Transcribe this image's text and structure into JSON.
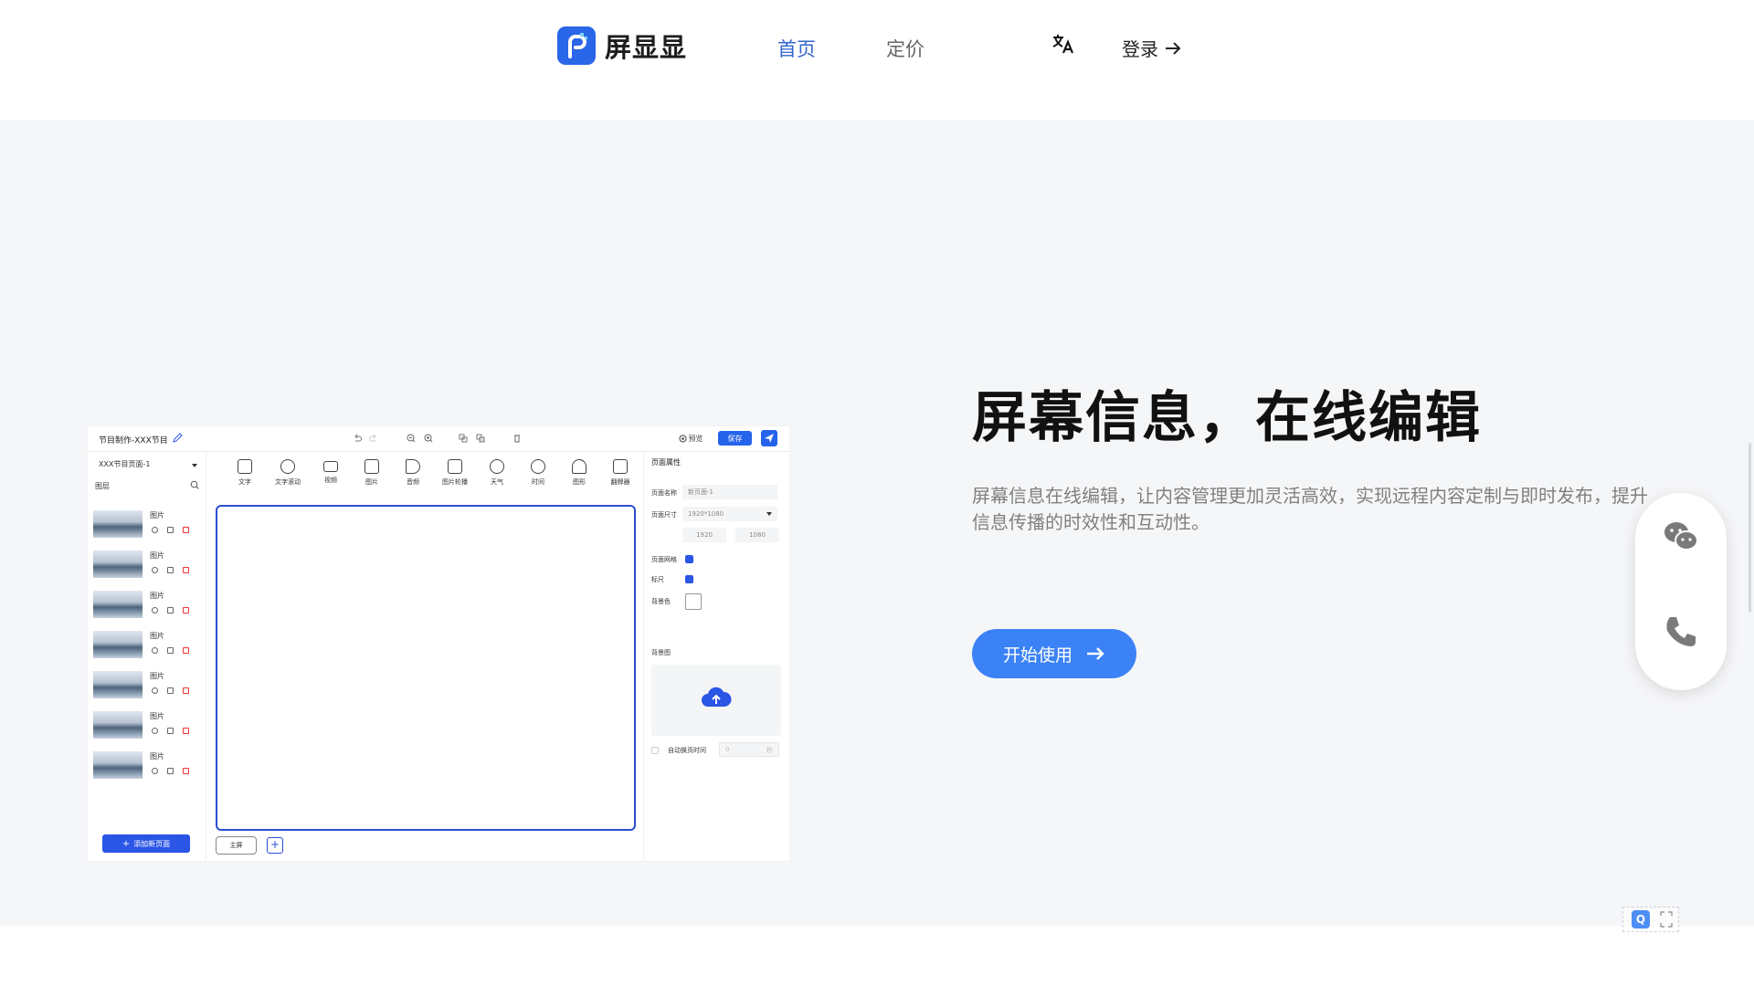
{
  "brand": {
    "name": "屏显显",
    "accent": "#2a66e8"
  },
  "nav": {
    "home": "首页",
    "pricing": "定价",
    "login": "登录",
    "translate_icon": "translate-icon"
  },
  "hero": {
    "title": "屏幕信息，在线编辑",
    "description": "屏幕信息在线编辑，让内容管理更加灵活高效，实现远程内容定制与即时发布，提升信息传播的时效性和互动性。",
    "cta": "开始使用"
  },
  "editor": {
    "title": "节目制作-XXX节目",
    "preview": "预览",
    "save": "保存",
    "page_select": "XXX节目页面-1",
    "layers_label": "图层",
    "layer_name": "图片",
    "layers": [
      "图片",
      "图片",
      "图片",
      "图片",
      "图片",
      "图片",
      "图片"
    ],
    "add_page": "添加新页面",
    "screen_tab": "主屏",
    "toolbar": [
      {
        "label": "文字",
        "icon": "text-icon"
      },
      {
        "label": "文字滚动",
        "icon": "scrolling-text-icon"
      },
      {
        "label": "视频",
        "icon": "video-icon"
      },
      {
        "label": "图片",
        "icon": "image-icon"
      },
      {
        "label": "音频",
        "icon": "audio-icon"
      },
      {
        "label": "图片轮播",
        "icon": "carousel-icon"
      },
      {
        "label": "天气",
        "icon": "weather-icon"
      },
      {
        "label": "时间",
        "icon": "clock-icon"
      },
      {
        "label": "图形",
        "icon": "shape-icon"
      },
      {
        "label": "翻牌器",
        "icon": "flip-counter-icon"
      }
    ],
    "props": {
      "title": "页面属性",
      "page_name_label": "页面名称",
      "page_name_value": "新页面-1",
      "page_size_label": "页面尺寸",
      "page_size_value": "1920*1080",
      "width": "1920",
      "height": "1080",
      "grid_label": "页面网格",
      "ruler_label": "标尺",
      "bg_color_label": "背景色",
      "bg_image_label": "背景图",
      "auto_switch_label": "自动换页时间",
      "auto_switch_value": "0",
      "auto_switch_unit": "秒"
    }
  },
  "contact": {
    "wechat": "wechat-icon",
    "phone": "phone-icon"
  },
  "mini_widget": {
    "letter": "Q"
  }
}
